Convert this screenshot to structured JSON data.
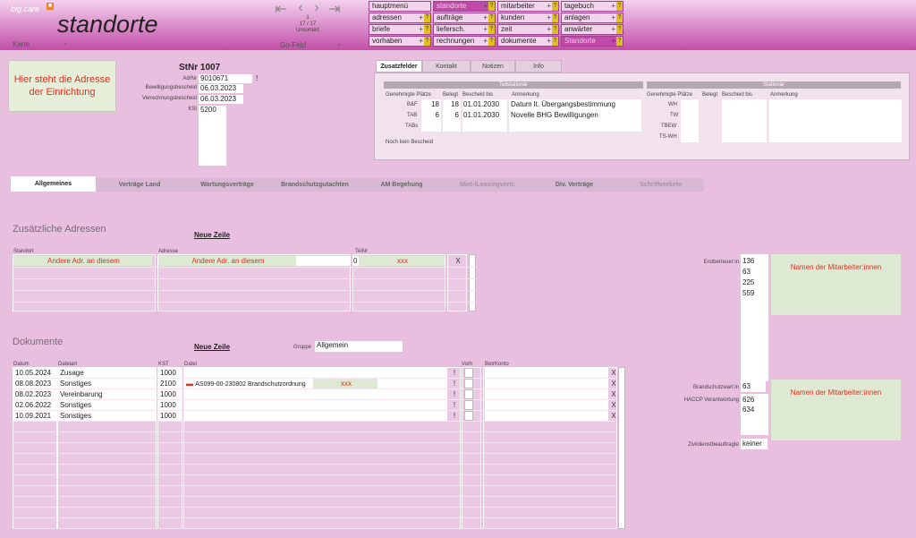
{
  "header": {
    "brand": "big.care",
    "title": "standorte",
    "karte_label": "Karte",
    "record_number": "1",
    "record_count": "17 / 17",
    "sort_status": "Unsortiert",
    "gofeld_label": "Go-Feld"
  },
  "menu": {
    "col1": [
      "hauptmenü",
      "adressen",
      "briefe",
      "vorhaben"
    ],
    "col2": [
      "standorte",
      "aufträge",
      "liefersch.",
      "rechnungen"
    ],
    "col3": [
      "mitarbeiter",
      "kunden",
      "zeit",
      "dokumente"
    ],
    "col4": [
      "tagebuch",
      "anlagen",
      "anwärter",
      "Standorte"
    ],
    "plus": "+",
    "q": "?"
  },
  "address_box": "Hier steht die Adresse der Einrichtung",
  "stnr": "StNr 1007",
  "fields": {
    "adrnr_label": "AdrNr",
    "adrnr": "9010671",
    "bewilligung_label": "Bewilligungsbescheid",
    "bewilligung": "06.03.2023",
    "verrechnung_label": "Verrechnungsbescheid",
    "verrechnung": "06.03.2023",
    "kst_label": "KSt",
    "kst": "5200",
    "excl": "!"
  },
  "top_tabs": [
    "Zusatzfelder",
    "Kontakt",
    "Notizen",
    "Info"
  ],
  "teilstationaer": {
    "header": "Teilstationär",
    "cols": [
      "Genehmigte Plätze",
      "Belegt",
      "Bescheid bis",
      "Anmerkung"
    ],
    "rows": [
      {
        "label": "B&F",
        "plaetze": "18",
        "belegt": "18",
        "bis": "01.01.2030",
        "anm": "Datum lt. Übergangsbestimmung"
      },
      {
        "label": "TAB",
        "plaetze": "6",
        "belegt": "6",
        "bis": "01.01.2030",
        "anm": "Novelle BHG Bewilligungen"
      },
      {
        "label": "TABs",
        "plaetze": "",
        "belegt": "",
        "bis": "",
        "anm": ""
      }
    ],
    "note": "Noch kein Bescheid"
  },
  "stationaer": {
    "header": "Stationär",
    "cols": [
      "Genehmigte Plätze",
      "Belegt",
      "Bescheid bis",
      "Anmerkung"
    ],
    "rows": [
      "WH",
      "TW",
      "TBEW",
      "TS-WH"
    ]
  },
  "main_tabs": [
    "Allgemeines",
    "Verträge Land",
    "Wartungsverträge",
    "Brandschutzgutachten",
    "AM Begehung",
    "Miet-/Leasingvertr.",
    "Div. Verträge",
    "Schriftverkehr"
  ],
  "zusatz": {
    "title": "Zusätzliche Adressen",
    "new_row": "Neue Zeile",
    "col_standort": "Standort",
    "col_adresse": "Adresse",
    "col_telnr": "TelNr",
    "row_standort": "Andere Adr. an diesem",
    "row_adresse": "Andere Adr. an diesem",
    "row_telnr": "xxx",
    "x": "X",
    "telnr_prefix": "0"
  },
  "dokumente": {
    "title": "Dokumente",
    "new_row": "Neue Zeile",
    "gruppe_label": "Gruppe",
    "gruppe": "Allgemein",
    "cols": [
      "Datum",
      "Dateiart",
      "KST",
      "Datei",
      "Vorh",
      "BetrKonto"
    ],
    "rows": [
      {
        "datum": "10.05.2024",
        "art": "Zusage",
        "kst": "1000",
        "datei": ""
      },
      {
        "datum": "08.08.2023",
        "art": "Sonstiges",
        "kst": "2100",
        "datei": "AS099-00-230802 Brandschutzordnung"
      },
      {
        "datum": "08.02.2023",
        "art": "Vereinbarung",
        "kst": "1000",
        "datei": ""
      },
      {
        "datum": "02.06.2022",
        "art": "Sonstiges",
        "kst": "1000",
        "datei": ""
      },
      {
        "datum": "10.09.2021",
        "art": "Sonstiges",
        "kst": "1000",
        "datei": ""
      }
    ],
    "xxx": "xxx",
    "x": "X",
    "excl": "!"
  },
  "right": {
    "erstbetreuer_label": "Erstbetreuer:in",
    "erstbetreuer": [
      "136",
      "63",
      "225",
      "559"
    ],
    "names1": "Namen der Mitarbeiter:innen",
    "brandschutz_label": "Brandschutzwart:in",
    "brandschutz": "63",
    "haccp_label": "HACCP Verantwortung",
    "haccp": [
      "626",
      "634"
    ],
    "names2": "Namen der Mitarbeiter:innen",
    "zivil_label": "Zivildienstbeauftragte",
    "zivil": "keiner"
  },
  "colors": {
    "accent": "#c04aa8",
    "warning": "#e03020",
    "note_bg": "#dde9d2"
  }
}
